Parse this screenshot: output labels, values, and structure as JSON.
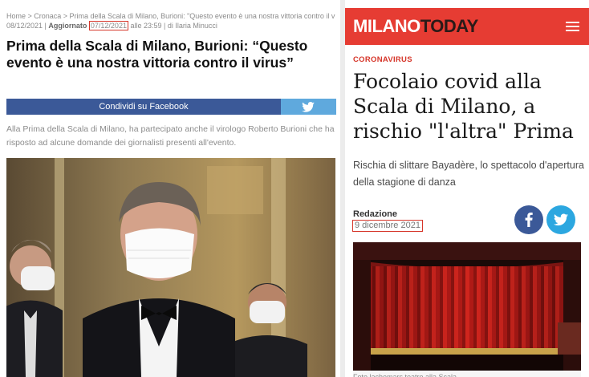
{
  "left": {
    "breadcrumb": "Home > Cronaca > Prima della Scala di Milano, Burioni: \"Questo evento è una nostra vittoria contro il virus\"",
    "published_date": "08/12/2021",
    "separator": " | ",
    "updated_label": "Aggiornato",
    "updated_date": "07/12/2021",
    "updated_time": "alle 23:59",
    "author": "di Ilaria Minucci",
    "title": "Prima della Scala di Milano, Burioni: “Questo evento è una nostra vittoria contro il virus”",
    "share_facebook": "Condividi su Facebook",
    "lead": "Alla Prima della Scala di Milano, ha partecipato anche il virologo Roberto Burioni che ha risposto ad alcune domande dei giornalisti presenti all'evento."
  },
  "right": {
    "logo_part1": "MILANO",
    "logo_part2": "TODAY",
    "category": "CORONAVIRUS",
    "title": "Focolaio covid alla Scala di Milano, a rischio \"l'altra\" Prima",
    "subtitle": "Rischia di slittare Bayadère, lo spettacolo d'apertura della stagione di danza",
    "author": "Redazione",
    "date": "9 dicembre 2021",
    "caption": "Foto lachemars teatro alla Scala"
  },
  "colors": {
    "brand_red": "#e63c33",
    "facebook": "#3b5998",
    "twitter": "#2ca7e0",
    "highlight_border": "#d6362a"
  },
  "icons": [
    "twitter-icon",
    "facebook-icon",
    "menu-icon"
  ]
}
